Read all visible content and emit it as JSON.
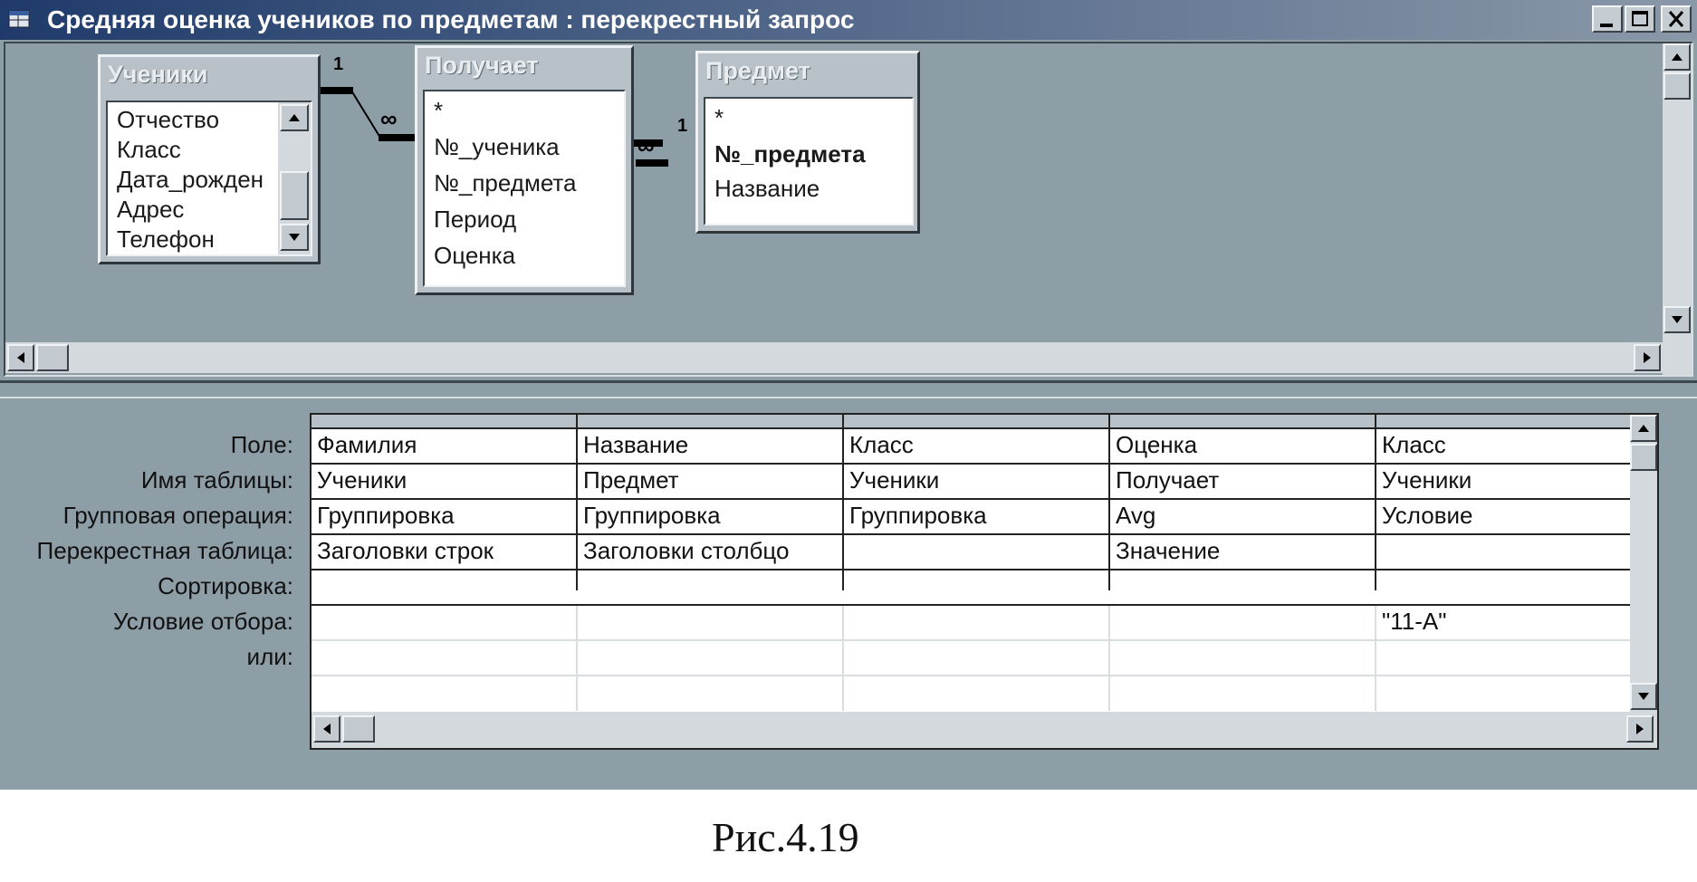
{
  "window": {
    "title": "Средняя оценка учеников по предметам : перекрестный запрос",
    "controls": [
      "minimize",
      "maximize",
      "close"
    ]
  },
  "tables": [
    {
      "name": "Ученики",
      "fields": [
        "Отчество",
        "Класс",
        "Дата_рожден",
        "Адрес",
        "Телефон"
      ]
    },
    {
      "name": "Получает",
      "fields": [
        "*",
        "№_ученика",
        "№_предмета",
        "Период",
        "Оценка"
      ]
    },
    {
      "name": "Предмет",
      "fields": [
        "*",
        "№_предмета",
        "Название"
      ],
      "key_field": "№_предмета"
    }
  ],
  "relations": [
    {
      "from": "Ученики",
      "to": "Получает",
      "from_card": "1",
      "to_card": "∞"
    },
    {
      "from": "Предмет",
      "to": "Получает",
      "from_card": "1",
      "to_card": "∞"
    }
  ],
  "grid": {
    "row_labels": [
      "Поле:",
      "Имя таблицы:",
      "Групповая операция:",
      "Перекрестная таблица:",
      "Сортировка:",
      "Условие отбора:",
      "или:"
    ],
    "columns": [
      {
        "field": "Фамилия",
        "table": "Ученики",
        "group": "Группировка",
        "crosstab": "Заголовки строк",
        "sort": "",
        "criteria": "",
        "or": ""
      },
      {
        "field": "Название",
        "table": "Предмет",
        "group": "Группировка",
        "crosstab": "Заголовки столбцо",
        "sort": "",
        "criteria": "",
        "or": ""
      },
      {
        "field": "Класс",
        "table": "Ученики",
        "group": "Группировка",
        "crosstab": "",
        "sort": "",
        "criteria": "",
        "or": ""
      },
      {
        "field": "Оценка",
        "table": "Получает",
        "group": "Avg",
        "crosstab": "Значение",
        "sort": "",
        "criteria": "",
        "or": ""
      },
      {
        "field": "Класс",
        "table": "Ученики",
        "group": "Условие",
        "crosstab": "",
        "sort": "",
        "criteria": "\"11-А\"",
        "or": ""
      }
    ]
  },
  "caption": "Рис.4.19",
  "colors": {
    "workspace": "#8e9ea7",
    "title_start": "#1f3b6b",
    "list_bg": "#ffffff"
  }
}
